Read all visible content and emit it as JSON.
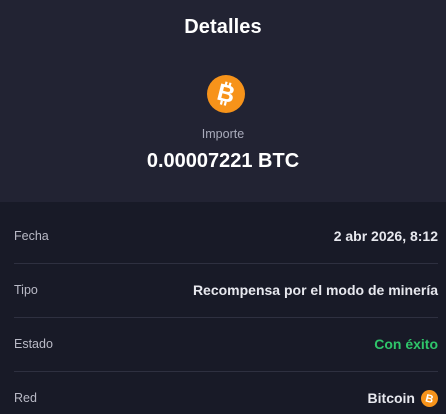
{
  "header": {
    "title": "Detalles",
    "coin_icon": "bitcoin-icon",
    "amount_label": "Importe",
    "amount": "0.00007221 BTC"
  },
  "details": [
    {
      "label": "Fecha",
      "value": "2 abr 2026, 8:12"
    },
    {
      "label": "Tipo",
      "value": "Recompensa por el modo de minería"
    },
    {
      "label": "Estado",
      "value": "Con éxito",
      "status_color": "#2fc56a"
    },
    {
      "label": "Red",
      "value": "Bitcoin",
      "icon": "bitcoin-icon"
    }
  ],
  "colors": {
    "bitcoin_orange": "#f7931a",
    "top_background": "#222333",
    "details_background": "#181a27",
    "success": "#2fc56a"
  }
}
